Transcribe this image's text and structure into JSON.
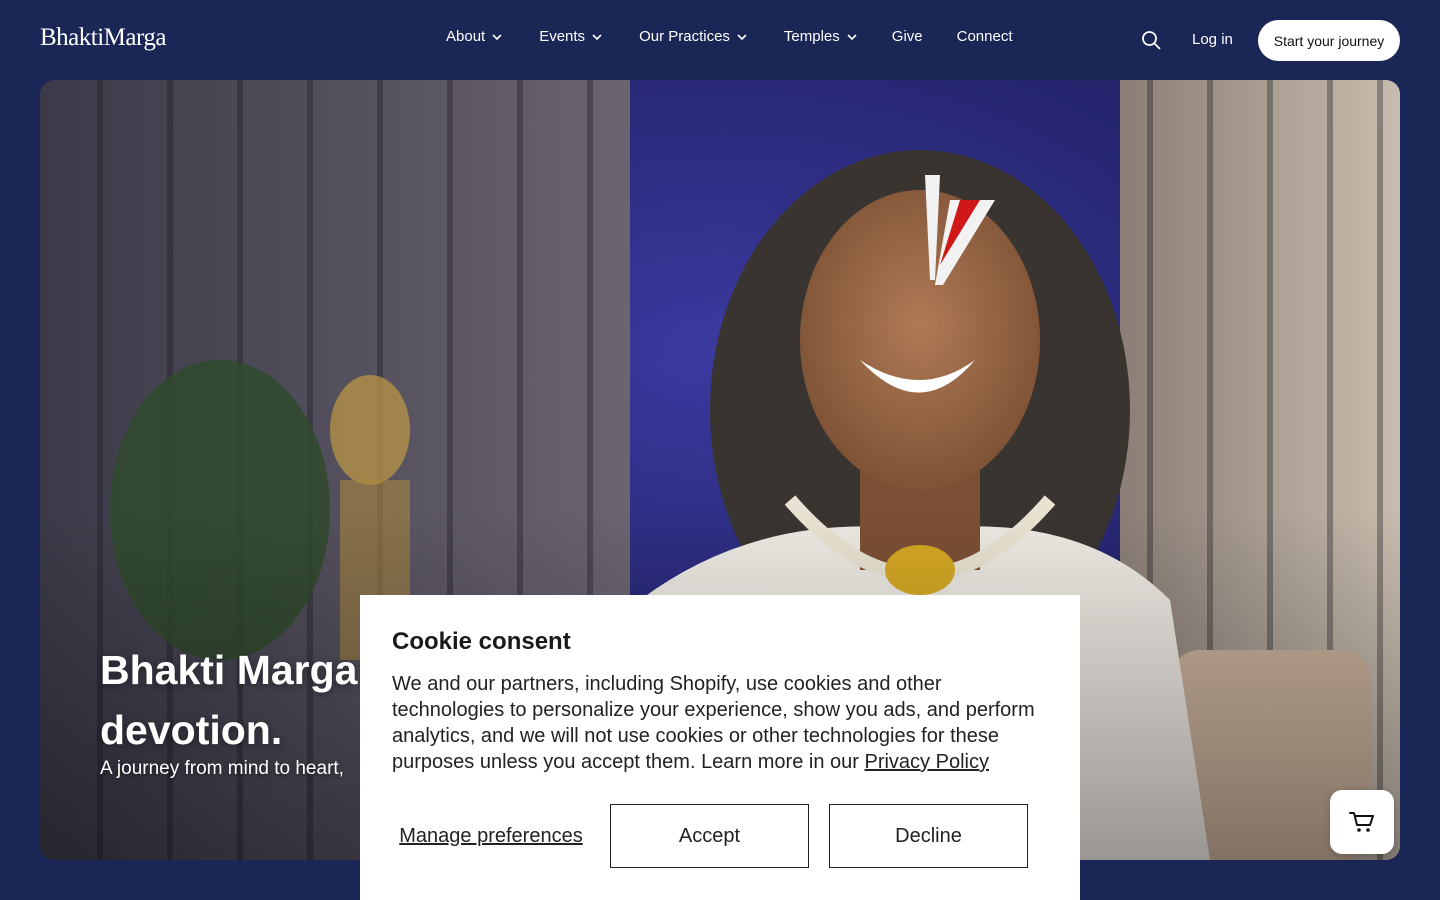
{
  "header": {
    "logo": "BhaktiMarga",
    "nav": [
      {
        "label": "About",
        "has_dropdown": true
      },
      {
        "label": "Events",
        "has_dropdown": true
      },
      {
        "label": "Our Practices",
        "has_dropdown": true
      },
      {
        "label": "Temples",
        "has_dropdown": true
      },
      {
        "label": "Give",
        "has_dropdown": false
      },
      {
        "label": "Connect",
        "has_dropdown": false
      }
    ],
    "search_icon": "search-icon",
    "login_label": "Log in",
    "cta_label": "Start your journey"
  },
  "hero": {
    "title_line1": "Bhakti Marga",
    "title_line2": "devotion.",
    "subtitle": "A journey from mind to heart,",
    "cart_icon": "cart-icon"
  },
  "cookie": {
    "title": "Cookie consent",
    "body": "We and our partners, including Shopify, use cookies and other technologies to personalize your experience, show you ads, and perform analytics, and we will not use cookies or other technologies for these purposes unless you accept them. Learn more in our ",
    "privacy_link": "Privacy Policy",
    "manage_label": "Manage preferences",
    "accept_label": "Accept",
    "decline_label": "Decline"
  },
  "colors": {
    "page_bg": "#1a2655",
    "header_text": "#ffffff",
    "cta_bg": "#ffffff"
  }
}
